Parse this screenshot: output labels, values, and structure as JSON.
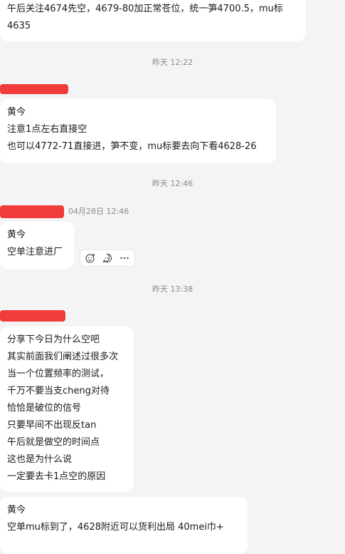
{
  "messages": {
    "m1": {
      "lines": [
        "午后关注4674先空，4679-80加正常苍位，统一笋4700.5，mu标",
        "4635"
      ]
    },
    "ts1": "昨天 12:22",
    "m2": {
      "lines": [
        "黄今",
        "注意1点左右直接空",
        "也可以4772-71直接进，笋不变，mu标要去向下看4628-26"
      ]
    },
    "ts2": "昨天 12:46",
    "m3": {
      "sender_time": "04月28日 12:46",
      "lines": [
        "黄今",
        "空单注意进厂"
      ]
    },
    "ts3": "昨天 13:38",
    "m4": {
      "lines": [
        "分享下今日为什么空吧",
        "其实前面我们阐述过很多次",
        "当一个位置频率的测试，",
        "千万不要当支cheng对待",
        "恰恰是破位的信号",
        "只要早间不出现反tan",
        "午后就是做空的时间点",
        "这也是为什么说",
        "一定要去卡1点空的原因"
      ]
    },
    "m5": {
      "lines": [
        "黄今",
        "空单mu标到了，4628附近可以货利出局   40mei巾+"
      ]
    }
  },
  "actions": {
    "icons": [
      "emoji-reaction-icon",
      "reply-icon",
      "more-icon"
    ]
  },
  "colors": {
    "background": "#f4f4f5",
    "bubble": "#ffffff",
    "redaction": "#f23b3b",
    "timestamp": "#8a8a8a"
  }
}
